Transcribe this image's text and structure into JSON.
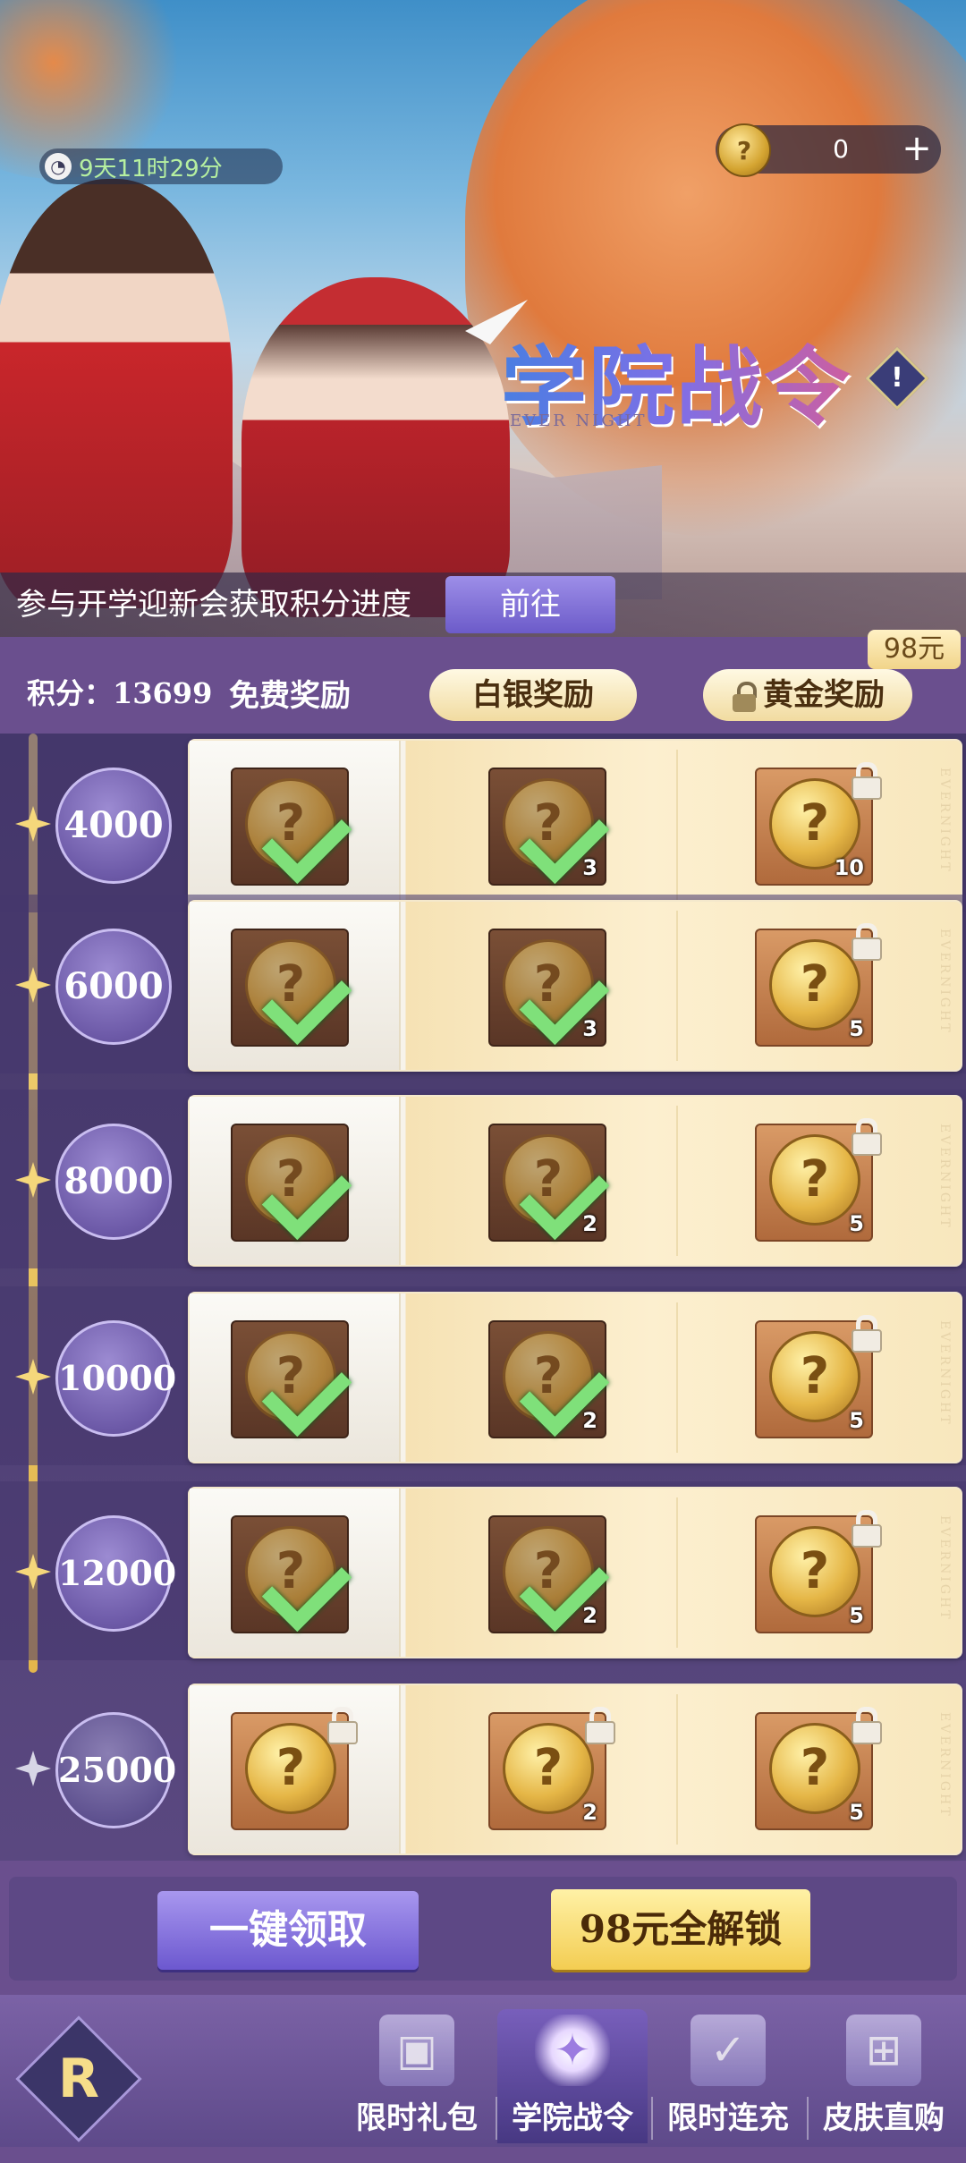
{
  "banner": {
    "timer": "9天11时29分",
    "currency_value": "0",
    "title": "学院战令",
    "subtitle": "EVER NIGHT",
    "info_icon": "exclamation-icon",
    "task_text": "参与开学迎新会获取积分进度",
    "task_button": "前往"
  },
  "header": {
    "price_tag": "98元",
    "score_label": "积分：13699",
    "free_label": "免费奖励",
    "silver_label": "白银奖励",
    "gold_label": "黄金奖励"
  },
  "rows": [
    {
      "level": "4000",
      "free": {
        "claimed": true
      },
      "silver": {
        "claimed": true,
        "qty": "3"
      },
      "gold": {
        "locked": true,
        "qty": "10"
      }
    },
    {
      "level": "6000",
      "free": {
        "claimed": true
      },
      "silver": {
        "claimed": true,
        "qty": "3"
      },
      "gold": {
        "locked": true,
        "qty": "5"
      }
    },
    {
      "level": "8000",
      "free": {
        "claimed": true
      },
      "silver": {
        "claimed": true,
        "qty": "2"
      },
      "gold": {
        "locked": true,
        "qty": "5"
      }
    },
    {
      "level": "10000",
      "free": {
        "claimed": true
      },
      "silver": {
        "claimed": true,
        "qty": "2"
      },
      "gold": {
        "locked": true,
        "qty": "5"
      }
    },
    {
      "level": "12000",
      "free": {
        "claimed": true
      },
      "silver": {
        "claimed": true,
        "qty": "2"
      },
      "gold": {
        "locked": true,
        "qty": "5"
      }
    },
    {
      "level": "25000",
      "free": {
        "locked": true
      },
      "silver": {
        "locked": true,
        "qty": "2"
      },
      "gold": {
        "locked": true,
        "qty": "5"
      }
    }
  ],
  "card_watermark": "EVERNIGHT",
  "coin_glyph": "?",
  "actions": {
    "claim_all": "一键领取",
    "unlock_all": "98元全解锁"
  },
  "nav": {
    "items": [
      {
        "label": "限时礼包",
        "icon": "gift-chest-icon"
      },
      {
        "label": "学院战令",
        "icon": "star-flower-icon"
      },
      {
        "label": "限时连充",
        "icon": "clipboard-check-icon"
      },
      {
        "label": "皮肤直购",
        "icon": "gift-box-icon"
      }
    ],
    "active_index": 1
  },
  "colors": {
    "accent_purple": "#6c5bc9",
    "gold": "#f3cd52",
    "check_green": "#7fe07a"
  }
}
